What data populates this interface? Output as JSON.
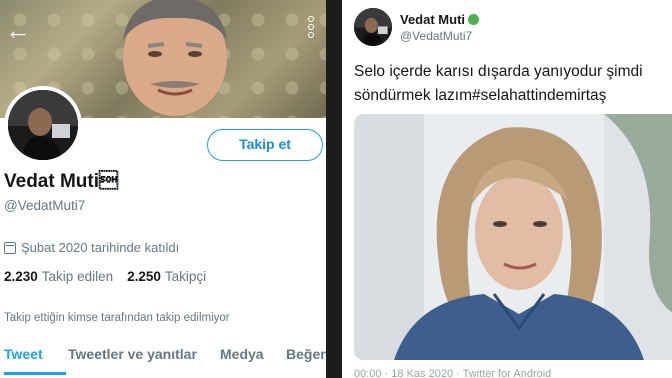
{
  "profile": {
    "display_name": "Vedat Muti\u0001",
    "handle": "@VedatMuti7",
    "follow_button": "Takip et",
    "joined": "Şubat 2020 tarihinde katıldı",
    "following_count": "2.230",
    "following_label": "Takip edilen",
    "followers_count": "2.250",
    "followers_label": "Takipçi",
    "follow_note": "Takip ettiğin kimse tarafından takip edilmiyor",
    "tabs": [
      "Tweet",
      "Tweetler ve yanıtlar",
      "Medya",
      "Beğen"
    ]
  },
  "tweet": {
    "author_name": "Vedat Muti",
    "author_handle": "@VedatMuti7",
    "text_line1": "Selo içerde karısı dışarda yanıyodur şimdi",
    "text_line2": "söndürmek lazım#selahattindemirtaş",
    "meta": "00:00 · 18 Kas 2020 · Twitter for Android"
  },
  "colors": {
    "accent": "#1da1f2",
    "text": "#14171a",
    "secondary": "#657786",
    "status_dot": "#4caf50"
  },
  "icons": {
    "back": "arrow-left-icon",
    "more": "more-vertical-icon",
    "calendar": "calendar-icon"
  }
}
